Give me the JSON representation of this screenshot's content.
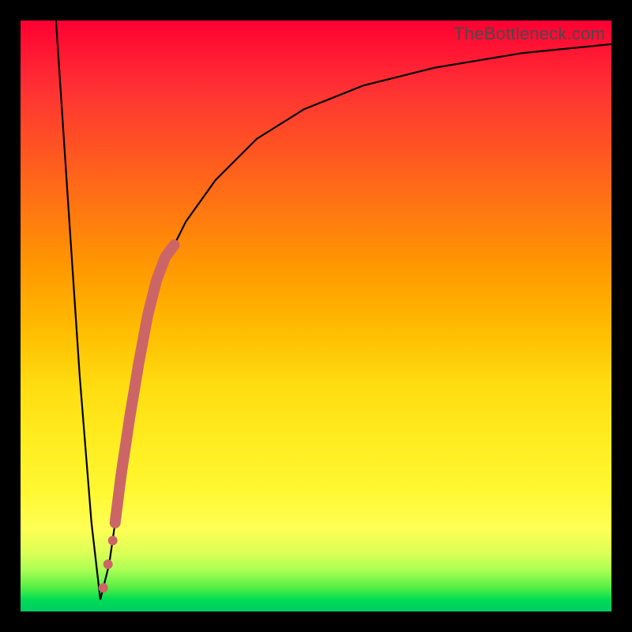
{
  "watermark": "TheBottleneck.com",
  "chart_data": {
    "type": "line",
    "title": "",
    "xlabel": "",
    "ylabel": "",
    "xlim": [
      0,
      100
    ],
    "ylim": [
      0,
      100
    ],
    "series": [
      {
        "name": "bottleneck-curve",
        "x": [
          6,
          8,
          10,
          12,
          13.5,
          15,
          17,
          19,
          21,
          24,
          28,
          33,
          40,
          48,
          58,
          70,
          85,
          100
        ],
        "y": [
          100,
          70,
          40,
          15,
          2,
          8,
          22,
          36,
          48,
          58,
          66,
          73,
          80,
          85,
          89,
          92,
          94.5,
          96
        ]
      }
    ],
    "highlight_segment": {
      "name": "thick-marker-band",
      "x": [
        16,
        17,
        18.5,
        20,
        21.5,
        23,
        24.5,
        26
      ],
      "y": [
        15,
        23,
        33,
        42,
        50,
        56,
        60,
        62
      ],
      "color": "#cc6666"
    },
    "highlight_dots": {
      "name": "small-markers",
      "points": [
        {
          "x": 14.0,
          "y": 4
        },
        {
          "x": 14.8,
          "y": 8
        },
        {
          "x": 15.6,
          "y": 12
        }
      ],
      "color": "#cc6666"
    }
  }
}
